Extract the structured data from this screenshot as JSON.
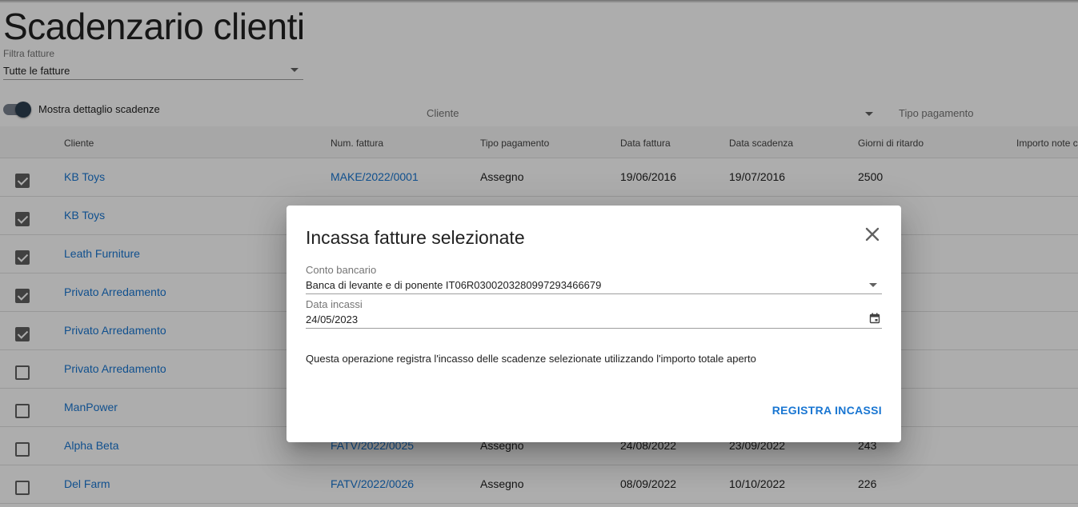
{
  "page": {
    "title": "Scadenzario clienti"
  },
  "filter": {
    "label": "Filtra fatture",
    "value": "Tutte le fatture"
  },
  "toggle": {
    "label": "Mostra dettaglio scadenze",
    "on": true
  },
  "column_filters": {
    "cliente_placeholder": "Cliente",
    "tipo_placeholder": "Tipo pagamento"
  },
  "table": {
    "headers": {
      "cliente": "Cliente",
      "num": "Num. fattura",
      "tipo": "Tipo pagamento",
      "data_fattura": "Data fattura",
      "data_scadenza": "Data scadenza",
      "giorni": "Giorni di ritardo",
      "importo": "Importo note c"
    },
    "rows": [
      {
        "checked": true,
        "cliente": "KB Toys",
        "num": "MAKE/2022/0001",
        "tipo": "Assegno",
        "data_fattura": "19/06/2016",
        "data_scadenza": "19/07/2016",
        "giorni": "2500"
      },
      {
        "checked": true,
        "cliente": "KB Toys",
        "num": "",
        "tipo": "",
        "data_fattura": "",
        "data_scadenza": "",
        "giorni": ""
      },
      {
        "checked": true,
        "cliente": "Leath Furniture",
        "num": "",
        "tipo": "",
        "data_fattura": "",
        "data_scadenza": "",
        "giorni": ""
      },
      {
        "checked": true,
        "cliente": "Privato Arredamento",
        "num": "",
        "tipo": "",
        "data_fattura": "",
        "data_scadenza": "",
        "giorni": ""
      },
      {
        "checked": true,
        "cliente": "Privato Arredamento",
        "num": "",
        "tipo": "",
        "data_fattura": "",
        "data_scadenza": "",
        "giorni": ""
      },
      {
        "checked": false,
        "cliente": "Privato Arredamento",
        "num": "",
        "tipo": "",
        "data_fattura": "",
        "data_scadenza": "",
        "giorni": ""
      },
      {
        "checked": false,
        "cliente": "ManPower",
        "num": "",
        "tipo": "",
        "data_fattura": "",
        "data_scadenza": "",
        "giorni": ""
      },
      {
        "checked": false,
        "cliente": "Alpha Beta",
        "num": "FATV/2022/0025",
        "tipo": "Assegno",
        "data_fattura": "24/08/2022",
        "data_scadenza": "23/09/2022",
        "giorni": "243"
      },
      {
        "checked": false,
        "cliente": "Del Farm",
        "num": "FATV/2022/0026",
        "tipo": "Assegno",
        "data_fattura": "08/09/2022",
        "data_scadenza": "10/10/2022",
        "giorni": "226"
      }
    ]
  },
  "dialog": {
    "title": "Incassa fatture selezionate",
    "conto_label": "Conto bancario",
    "conto_value": "Banca di levante e di ponente IT06R0300203280997293466679",
    "data_label": "Data incassi",
    "data_value": "24/05/2023",
    "message": "Questa operazione registra l'incasso delle scadenze selezionate utilizzando l'importo totale aperto",
    "action": "REGISTRA INCASSI"
  },
  "colors": {
    "link": "#1976d2",
    "scrim": "rgba(0,0,0,0.32)"
  },
  "icons": {
    "close": "close-icon",
    "calendar": "calendar-icon",
    "dropdown": "chevron-down-icon"
  }
}
